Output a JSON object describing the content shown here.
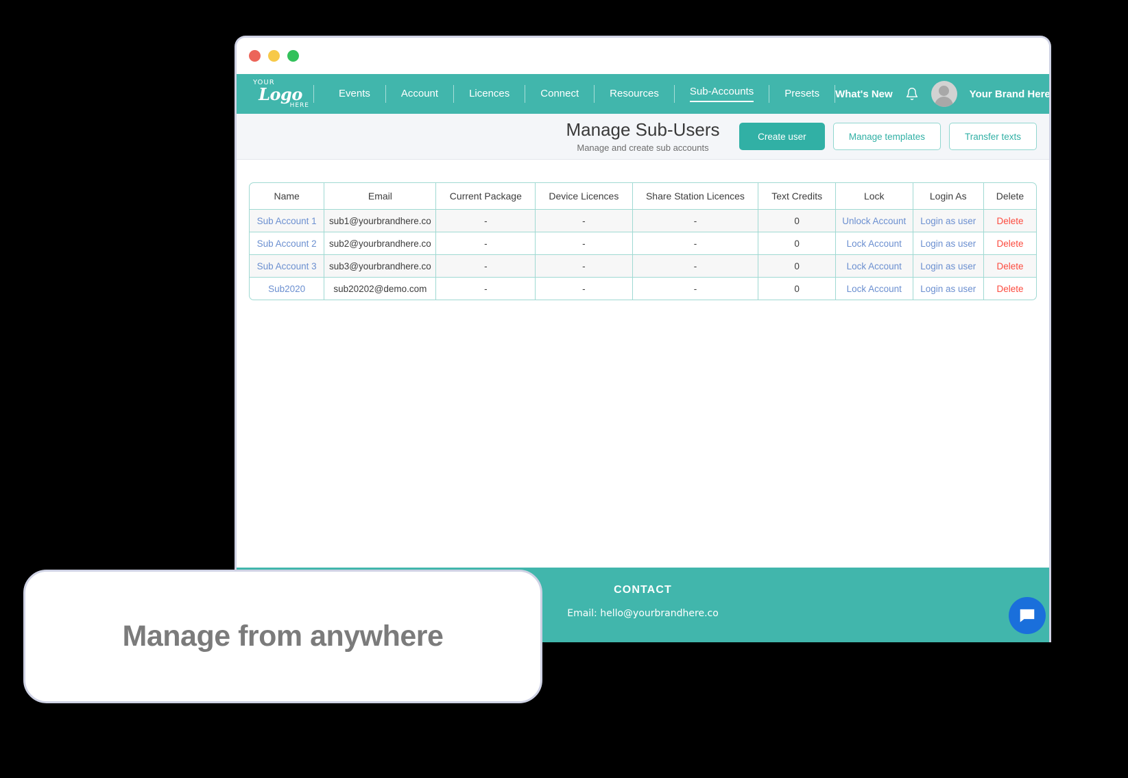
{
  "window": {
    "traffic_lights": [
      "close",
      "minimize",
      "maximize"
    ]
  },
  "navbar": {
    "logo": {
      "line1": "YOUR",
      "line2": "Logo",
      "line3": "HERE"
    },
    "items": [
      {
        "label": "Events",
        "active": false
      },
      {
        "label": "Account",
        "active": false
      },
      {
        "label": "Licences",
        "active": false
      },
      {
        "label": "Connect",
        "active": false
      },
      {
        "label": "Resources",
        "active": false
      },
      {
        "label": "Sub-Accounts",
        "active": true
      },
      {
        "label": "Presets",
        "active": false
      }
    ],
    "whats_new": "What's New",
    "bell_icon": "bell-icon",
    "avatar_icon": "avatar-icon",
    "brand_name": "Your Brand Here",
    "background_color": "#41b6ac"
  },
  "page_header": {
    "title": "Manage Sub-Users",
    "subtitle": "Manage and create sub accounts",
    "buttons": [
      {
        "label": "Create user",
        "style": "primary"
      },
      {
        "label": "Manage templates",
        "style": "outline"
      },
      {
        "label": "Transfer texts",
        "style": "outline"
      }
    ]
  },
  "table": {
    "columns": [
      "Name",
      "Email",
      "Current Package",
      "Device Licences",
      "Share Station Licences",
      "Text Credits",
      "Lock",
      "Login As",
      "Delete"
    ],
    "rows": [
      {
        "name": "Sub Account 1",
        "email": "sub1@yourbrandhere.co",
        "current_package": "-",
        "device_licences": "-",
        "share_station_licences": "-",
        "text_credits": "0",
        "lock": "Unlock Account",
        "login_as": "Login as user",
        "delete": "Delete"
      },
      {
        "name": "Sub Account 2",
        "email": "sub2@yourbrandhere.co",
        "current_package": "-",
        "device_licences": "-",
        "share_station_licences": "-",
        "text_credits": "0",
        "lock": "Lock Account",
        "login_as": "Login as user",
        "delete": "Delete"
      },
      {
        "name": "Sub Account 3",
        "email": "sub3@yourbrandhere.co",
        "current_package": "-",
        "device_licences": "-",
        "share_station_licences": "-",
        "text_credits": "0",
        "lock": "Lock Account",
        "login_as": "Login as user",
        "delete": "Delete"
      },
      {
        "name": "Sub2020",
        "email": "sub20202@demo.com",
        "current_package": "-",
        "device_licences": "-",
        "share_station_licences": "-",
        "text_credits": "0",
        "lock": "Lock Account",
        "login_as": "Login as user",
        "delete": "Delete"
      }
    ],
    "border_color": "#9fd9d2",
    "link_color": "#6b8fd0",
    "delete_color": "#fc4b3f"
  },
  "footer": {
    "title": "CONTACT",
    "email": "Email: hello@yourbrandhere.co",
    "background_color": "#41b6ac"
  },
  "chat_launcher": {
    "icon": "chat-bubble-icon",
    "color": "#1a6fdb"
  },
  "callout": {
    "text": "Manage from anywhere"
  }
}
